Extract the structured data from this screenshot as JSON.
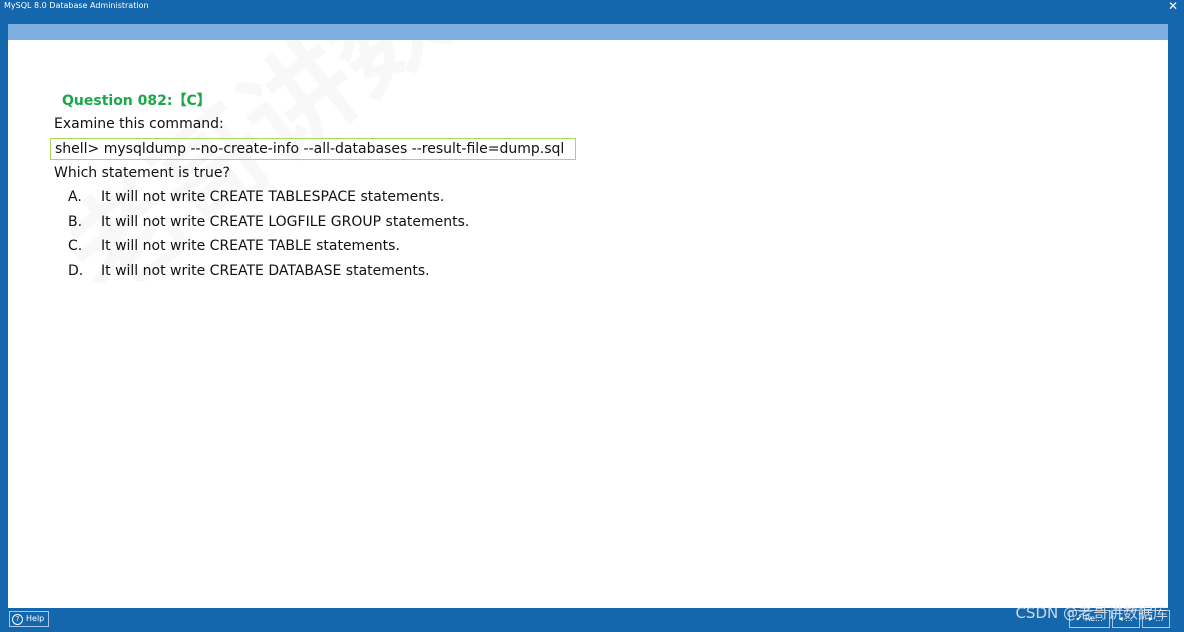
{
  "window": {
    "title": "MySQL 8.0 Database Administration",
    "close_glyph": "✕"
  },
  "question": {
    "title": "Question 082:【C】",
    "intro": "Examine this command:",
    "command": "shell> mysqldump --no-create-info --all-databases --result-file=dump.sql",
    "prompt": "Which statement is true?",
    "options": [
      {
        "letter": "A.",
        "text": "It will not write CREATE TABLESPACE statements."
      },
      {
        "letter": "B.",
        "text": "It will not write CREATE LOGFILE GROUP statements."
      },
      {
        "letter": "C.",
        "text": "It will not write CREATE TABLE statements."
      },
      {
        "letter": "D.",
        "text": "It will not write CREATE DATABASE statements."
      }
    ]
  },
  "watermark": {
    "text": "老哥讲数据库",
    "footer": "CSDN @老哥讲数据库"
  },
  "statusbar": {
    "help_label": "Help",
    "help_icon": "?",
    "nav": [
      "✔ Re...",
      "◂ ...",
      "▸ ..."
    ]
  },
  "colors": {
    "frame": "#1466ad",
    "header_strip": "#7eaedf",
    "answer_green": "#1aa84a",
    "command_border": "#a9d85a"
  }
}
